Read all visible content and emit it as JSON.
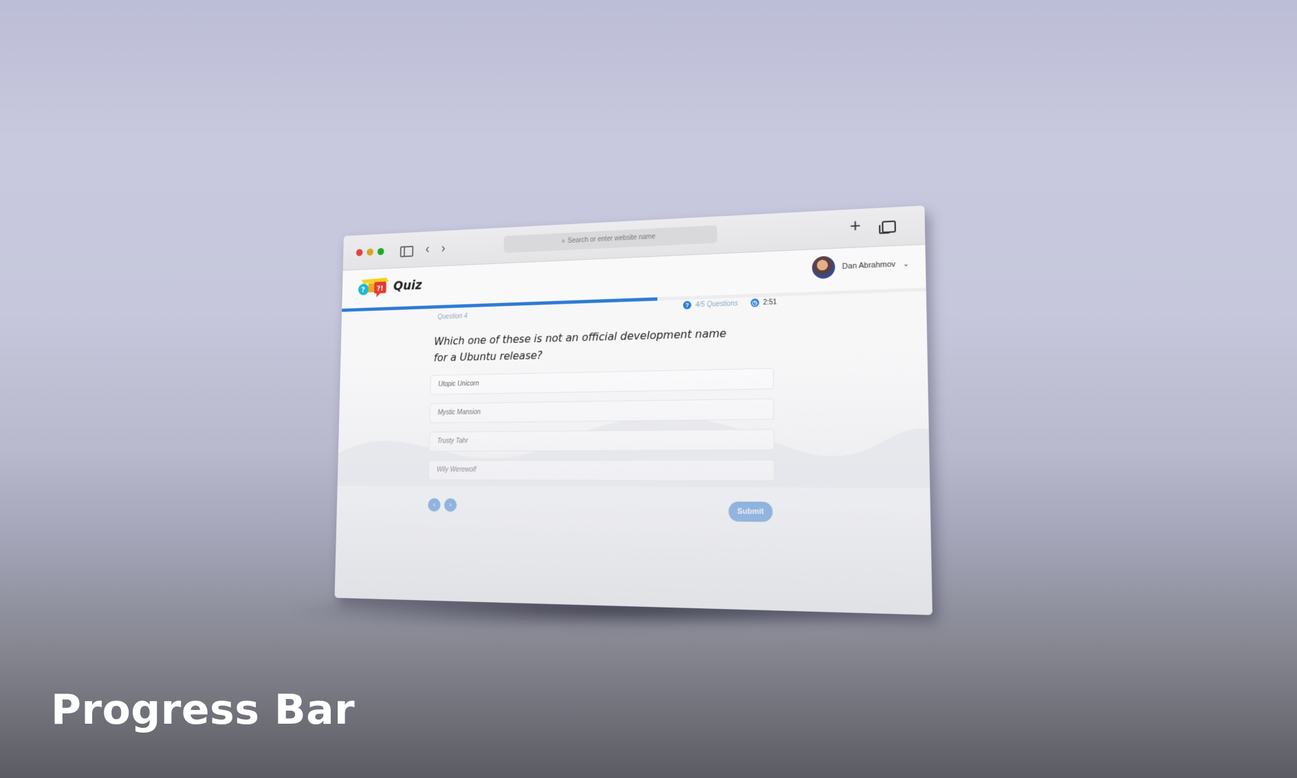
{
  "browser": {
    "address_placeholder": "Search or enter website name",
    "icons": [
      "close-dot",
      "minimize-dot",
      "zoom-dot",
      "sidebar-icon",
      "back-icon",
      "forward-icon",
      "search-icon",
      "new-tab-plus-icon",
      "tabs-overview-icon"
    ]
  },
  "app": {
    "logo_text": "Quiz",
    "user_name": "Dan Abrahmov",
    "user_menu_icon": "chevron-down-icon"
  },
  "quiz": {
    "progress_fraction": 0.57,
    "question_label": "Question 4",
    "questions_count": "4/5 Questions",
    "timer": "2:51",
    "question_text": "Which one of these is not an official development name for a Ubuntu release?",
    "options": [
      "Utopic Unicorn",
      "Mystic Mansion",
      "Trusty Tahr",
      "Wily Werewolf"
    ],
    "prev_label": "‹",
    "next_label": "›",
    "submit_label": "Submit"
  },
  "caption": "Progress Bar",
  "colors": {
    "accent": "#2d7bd4",
    "background": "#c6c7dc"
  }
}
